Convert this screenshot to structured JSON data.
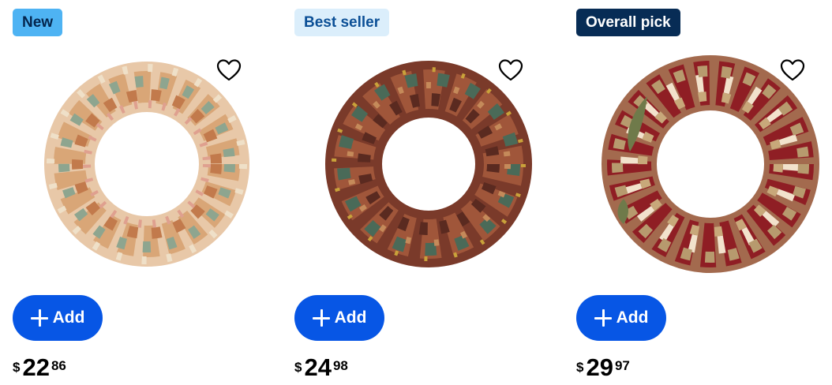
{
  "products": [
    {
      "badge": "New",
      "wreath": "autumn-leaf-wreath",
      "add_label": "Add",
      "currency": "$",
      "price_dollars": "22",
      "price_cents": "86"
    },
    {
      "badge": "Best seller",
      "wreath": "magnolia-leaf-wreath",
      "add_label": "Add",
      "currency": "$",
      "price_dollars": "24",
      "price_cents": "98"
    },
    {
      "badge": "Overall pick",
      "wreath": "hydrangea-wreath",
      "add_label": "Add",
      "currency": "$",
      "price_dollars": "29",
      "price_cents": "97"
    }
  ],
  "colors": {
    "add_button": "#0756e5",
    "badge_new": "#4eb3f3",
    "badge_best_seller": "#dbeefb",
    "badge_overall_pick": "#072c55"
  },
  "icons": {
    "favorite": "heart-outline-icon",
    "add": "plus-icon"
  }
}
